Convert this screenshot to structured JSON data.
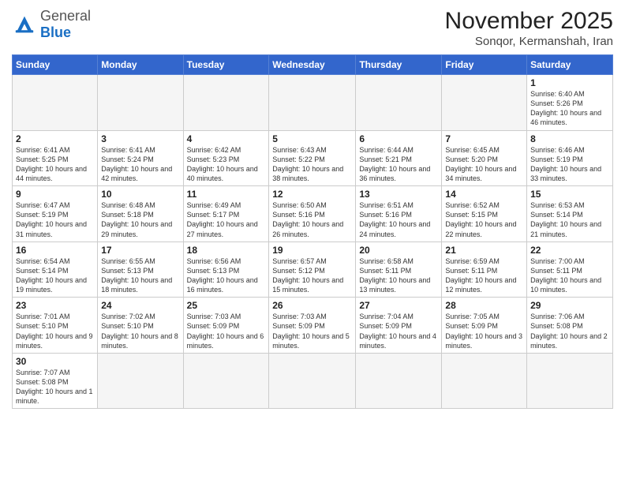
{
  "header": {
    "logo_general": "General",
    "logo_blue": "Blue",
    "title": "November 2025",
    "subtitle": "Sonqor, Kermanshah, Iran"
  },
  "weekdays": [
    "Sunday",
    "Monday",
    "Tuesday",
    "Wednesday",
    "Thursday",
    "Friday",
    "Saturday"
  ],
  "weeks": [
    [
      {
        "day": null
      },
      {
        "day": null
      },
      {
        "day": null
      },
      {
        "day": null
      },
      {
        "day": null
      },
      {
        "day": null
      },
      {
        "day": "1",
        "sunrise": "6:40 AM",
        "sunset": "5:26 PM",
        "daylight": "10 hours and 46 minutes."
      }
    ],
    [
      {
        "day": "2",
        "sunrise": "6:41 AM",
        "sunset": "5:25 PM",
        "daylight": "10 hours and 44 minutes."
      },
      {
        "day": "3",
        "sunrise": "6:41 AM",
        "sunset": "5:24 PM",
        "daylight": "10 hours and 42 minutes."
      },
      {
        "day": "4",
        "sunrise": "6:42 AM",
        "sunset": "5:23 PM",
        "daylight": "10 hours and 40 minutes."
      },
      {
        "day": "5",
        "sunrise": "6:43 AM",
        "sunset": "5:22 PM",
        "daylight": "10 hours and 38 minutes."
      },
      {
        "day": "6",
        "sunrise": "6:44 AM",
        "sunset": "5:21 PM",
        "daylight": "10 hours and 36 minutes."
      },
      {
        "day": "7",
        "sunrise": "6:45 AM",
        "sunset": "5:20 PM",
        "daylight": "10 hours and 34 minutes."
      },
      {
        "day": "8",
        "sunrise": "6:46 AM",
        "sunset": "5:19 PM",
        "daylight": "10 hours and 33 minutes."
      }
    ],
    [
      {
        "day": "9",
        "sunrise": "6:47 AM",
        "sunset": "5:19 PM",
        "daylight": "10 hours and 31 minutes."
      },
      {
        "day": "10",
        "sunrise": "6:48 AM",
        "sunset": "5:18 PM",
        "daylight": "10 hours and 29 minutes."
      },
      {
        "day": "11",
        "sunrise": "6:49 AM",
        "sunset": "5:17 PM",
        "daylight": "10 hours and 27 minutes."
      },
      {
        "day": "12",
        "sunrise": "6:50 AM",
        "sunset": "5:16 PM",
        "daylight": "10 hours and 26 minutes."
      },
      {
        "day": "13",
        "sunrise": "6:51 AM",
        "sunset": "5:16 PM",
        "daylight": "10 hours and 24 minutes."
      },
      {
        "day": "14",
        "sunrise": "6:52 AM",
        "sunset": "5:15 PM",
        "daylight": "10 hours and 22 minutes."
      },
      {
        "day": "15",
        "sunrise": "6:53 AM",
        "sunset": "5:14 PM",
        "daylight": "10 hours and 21 minutes."
      }
    ],
    [
      {
        "day": "16",
        "sunrise": "6:54 AM",
        "sunset": "5:14 PM",
        "daylight": "10 hours and 19 minutes."
      },
      {
        "day": "17",
        "sunrise": "6:55 AM",
        "sunset": "5:13 PM",
        "daylight": "10 hours and 18 minutes."
      },
      {
        "day": "18",
        "sunrise": "6:56 AM",
        "sunset": "5:13 PM",
        "daylight": "10 hours and 16 minutes."
      },
      {
        "day": "19",
        "sunrise": "6:57 AM",
        "sunset": "5:12 PM",
        "daylight": "10 hours and 15 minutes."
      },
      {
        "day": "20",
        "sunrise": "6:58 AM",
        "sunset": "5:11 PM",
        "daylight": "10 hours and 13 minutes."
      },
      {
        "day": "21",
        "sunrise": "6:59 AM",
        "sunset": "5:11 PM",
        "daylight": "10 hours and 12 minutes."
      },
      {
        "day": "22",
        "sunrise": "7:00 AM",
        "sunset": "5:11 PM",
        "daylight": "10 hours and 10 minutes."
      }
    ],
    [
      {
        "day": "23",
        "sunrise": "7:01 AM",
        "sunset": "5:10 PM",
        "daylight": "10 hours and 9 minutes."
      },
      {
        "day": "24",
        "sunrise": "7:02 AM",
        "sunset": "5:10 PM",
        "daylight": "10 hours and 8 minutes."
      },
      {
        "day": "25",
        "sunrise": "7:03 AM",
        "sunset": "5:09 PM",
        "daylight": "10 hours and 6 minutes."
      },
      {
        "day": "26",
        "sunrise": "7:03 AM",
        "sunset": "5:09 PM",
        "daylight": "10 hours and 5 minutes."
      },
      {
        "day": "27",
        "sunrise": "7:04 AM",
        "sunset": "5:09 PM",
        "daylight": "10 hours and 4 minutes."
      },
      {
        "day": "28",
        "sunrise": "7:05 AM",
        "sunset": "5:09 PM",
        "daylight": "10 hours and 3 minutes."
      },
      {
        "day": "29",
        "sunrise": "7:06 AM",
        "sunset": "5:08 PM",
        "daylight": "10 hours and 2 minutes."
      }
    ],
    [
      {
        "day": "30",
        "sunrise": "7:07 AM",
        "sunset": "5:08 PM",
        "daylight": "10 hours and 1 minute."
      },
      {
        "day": null
      },
      {
        "day": null
      },
      {
        "day": null
      },
      {
        "day": null
      },
      {
        "day": null
      },
      {
        "day": null
      }
    ]
  ]
}
